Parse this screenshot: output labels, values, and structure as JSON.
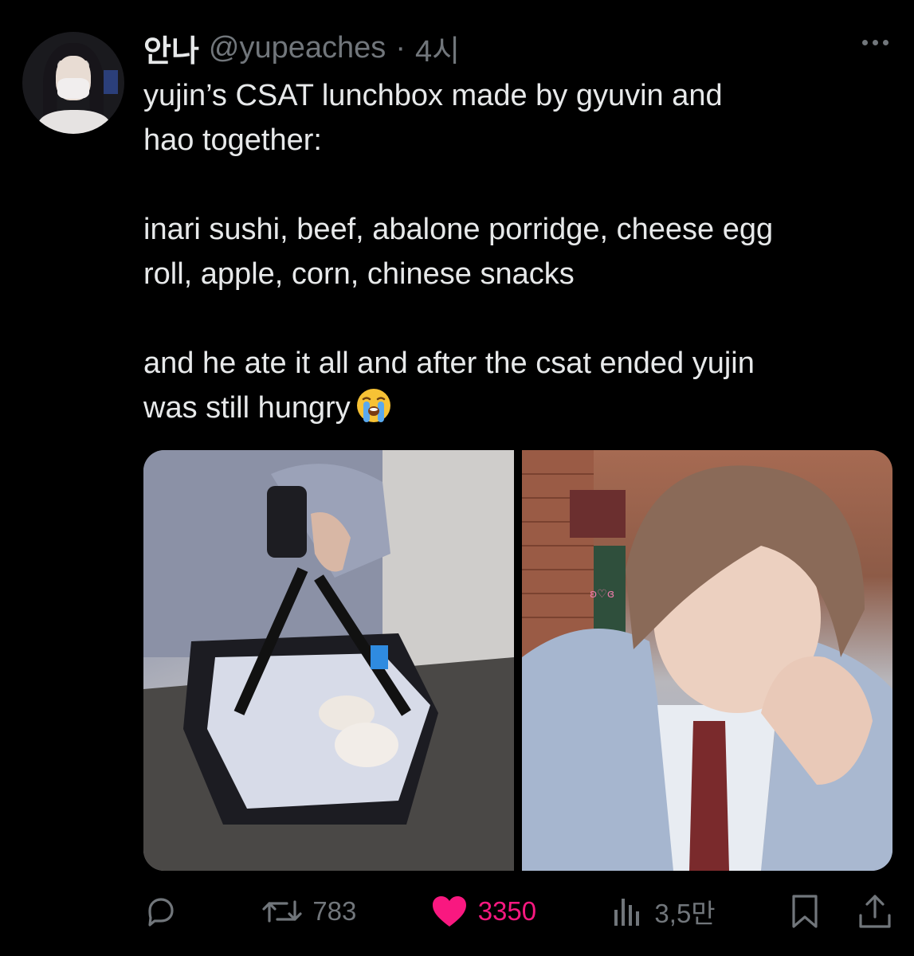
{
  "author": {
    "display_name": "안나",
    "handle": "@yupeaches",
    "separator": "·",
    "time": "4시"
  },
  "tweet": {
    "lines": [
      "yujin’s CSAT lunchbox made by gyuvin and",
      "hao together:",
      "",
      "inari sushi, beef, abalone porridge, cheese egg",
      "roll, apple, corn, chinese snacks",
      "",
      "and he ate it all and after the csat ended yujin",
      "was still hungry"
    ],
    "emoji": "loudly-crying-face"
  },
  "media": {
    "images": [
      {
        "name": "lunchbox-bag-photo"
      },
      {
        "name": "yujin-portrait-photo",
        "sticker_text": "ʚ♡ɞ"
      }
    ]
  },
  "actions": {
    "reply_count": "",
    "retweet_count": "783",
    "like_count": "3350",
    "views_count": "3,5만"
  },
  "colors": {
    "background": "#000000",
    "text": "#e7e9ea",
    "muted": "#71767b",
    "like": "#f91880"
  },
  "icons": [
    "more-icon",
    "reply-icon",
    "retweet-icon",
    "like-icon",
    "views-icon",
    "bookmark-icon",
    "share-icon"
  ]
}
